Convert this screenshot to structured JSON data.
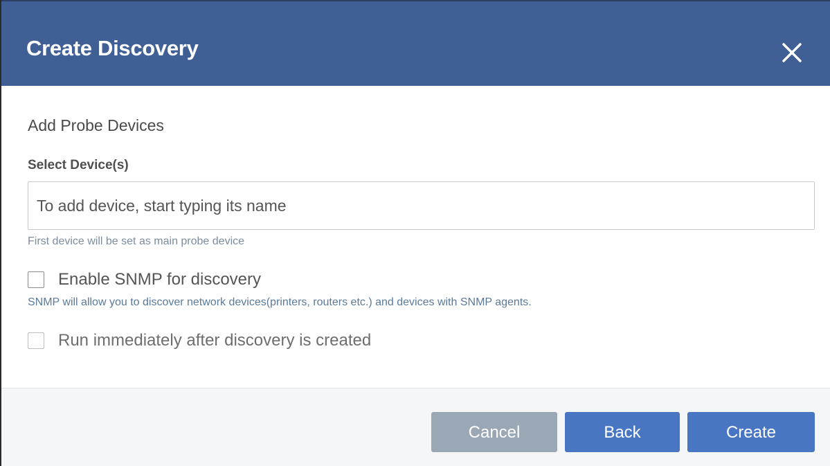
{
  "dialog": {
    "title": "Create Discovery",
    "close_icon": "close-icon",
    "header_color": "#3f5f95"
  },
  "form": {
    "section_title": "Add Probe Devices",
    "select_label": "Select Device(s)",
    "device_input": {
      "value": "",
      "placeholder": "To add device, start typing its name"
    },
    "device_hint": "First device will be set as main probe device",
    "snmp_checkbox": {
      "label": "Enable SNMP for discovery",
      "checked": false,
      "description": "SNMP will allow you to discover network devices(printers, routers etc.) and devices with SNMP agents."
    },
    "run_checkbox": {
      "label": "Run immediately after discovery is created",
      "checked": false,
      "disabled": true
    }
  },
  "footer": {
    "cancel_label": "Cancel",
    "back_label": "Back",
    "create_label": "Create",
    "button_color": "#4876c3",
    "cancel_color": "#9aa7b5"
  }
}
